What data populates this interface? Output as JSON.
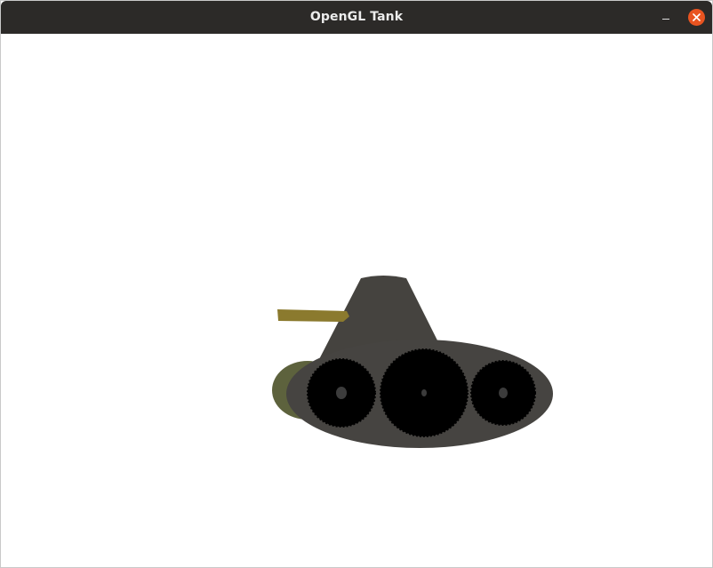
{
  "window": {
    "title": "OpenGL Tank"
  },
  "titlebar": {
    "background": "#2c2a28",
    "minimize_icon": "minimize-icon",
    "close_icon": "close-icon",
    "close_color": "#e95420"
  },
  "scene": {
    "background": "#ffffff",
    "colors": {
      "hull": "#464441",
      "turret": "#45433f",
      "barrel": "#8b7a2e",
      "hull_shadow": "#5d623d",
      "wheel": "#000000",
      "hub": "#3c3c3c"
    }
  }
}
